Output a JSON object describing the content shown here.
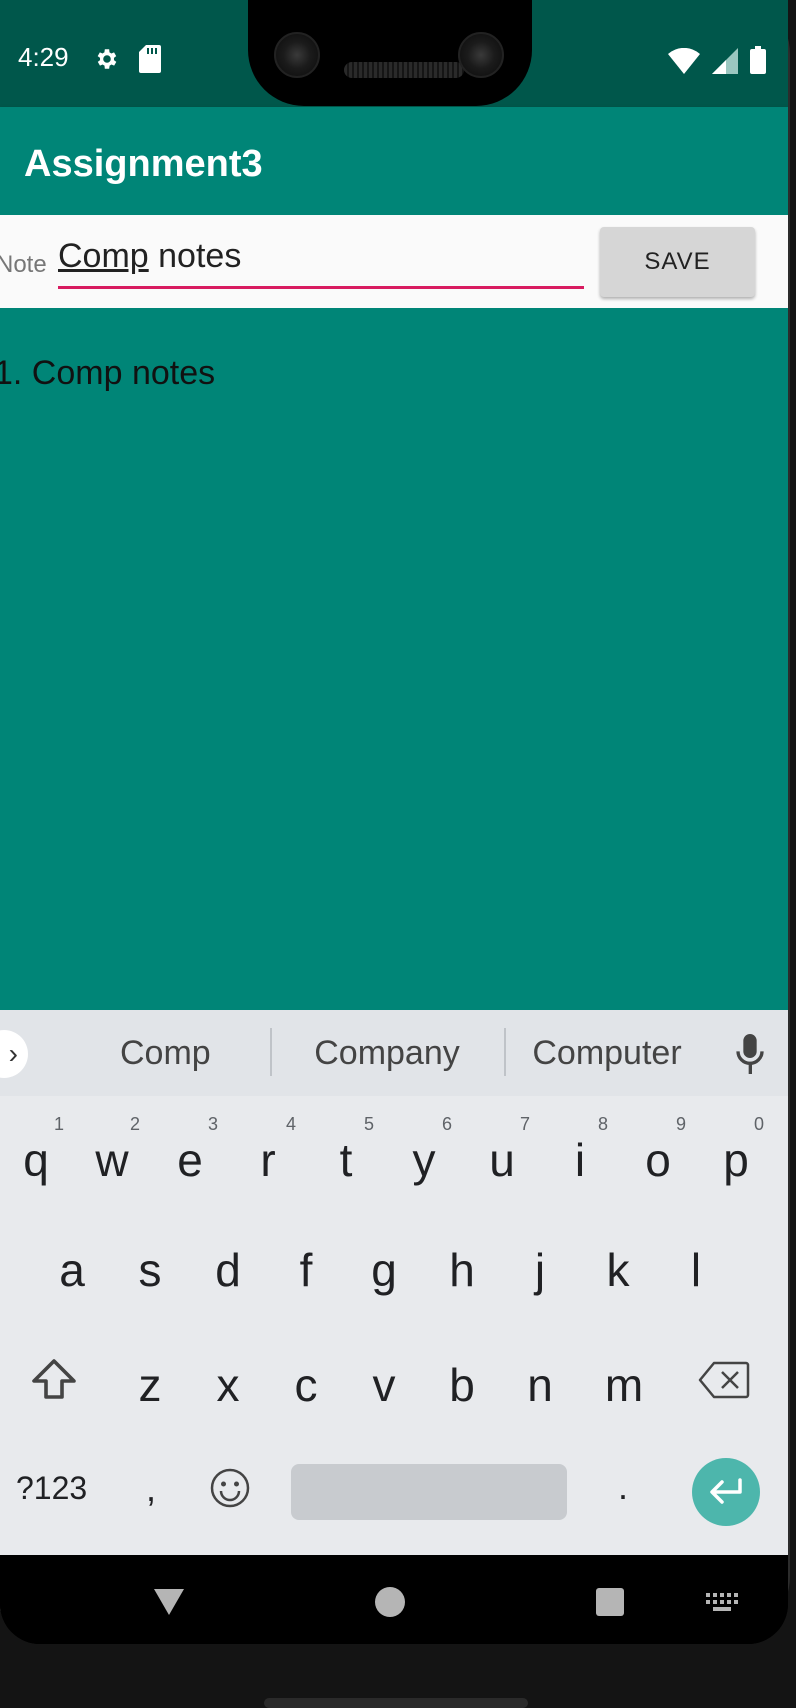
{
  "status_bar": {
    "time": "4:29",
    "bg_color": "#00574B",
    "icons_left": [
      "gear-icon",
      "sd-card-icon"
    ],
    "icons_right": [
      "wifi-icon",
      "signal-icon",
      "battery-icon"
    ]
  },
  "app_bar": {
    "title": "Assignment3",
    "bg_color": "#008577"
  },
  "note_form": {
    "label": "Note",
    "input_value_underlined": "Comp",
    "input_value_rest": " notes",
    "input_value": "Comp notes",
    "save_label": "SAVE",
    "accent_color": "#D81B60"
  },
  "notes_list": {
    "items": [
      {
        "label": "1. Comp notes"
      }
    ]
  },
  "keyboard": {
    "suggestions": [
      "Comp",
      "Company",
      "Computer"
    ],
    "row1": [
      {
        "key": "q",
        "hint": "1"
      },
      {
        "key": "w",
        "hint": "2"
      },
      {
        "key": "e",
        "hint": "3"
      },
      {
        "key": "r",
        "hint": "4"
      },
      {
        "key": "t",
        "hint": "5"
      },
      {
        "key": "y",
        "hint": "6"
      },
      {
        "key": "u",
        "hint": "7"
      },
      {
        "key": "i",
        "hint": "8"
      },
      {
        "key": "o",
        "hint": "9"
      },
      {
        "key": "p",
        "hint": "0"
      }
    ],
    "row2": [
      "a",
      "s",
      "d",
      "f",
      "g",
      "h",
      "j",
      "k",
      "l"
    ],
    "row3": [
      "z",
      "x",
      "c",
      "v",
      "b",
      "n",
      "m"
    ],
    "symbols_label": "?123",
    "comma_label": ",",
    "period_label": ".",
    "enter_color": "#4DB6AC"
  },
  "nav_bar": {
    "buttons": [
      "back-icon",
      "home-icon",
      "recents-icon",
      "keyboard-switch-icon"
    ]
  }
}
